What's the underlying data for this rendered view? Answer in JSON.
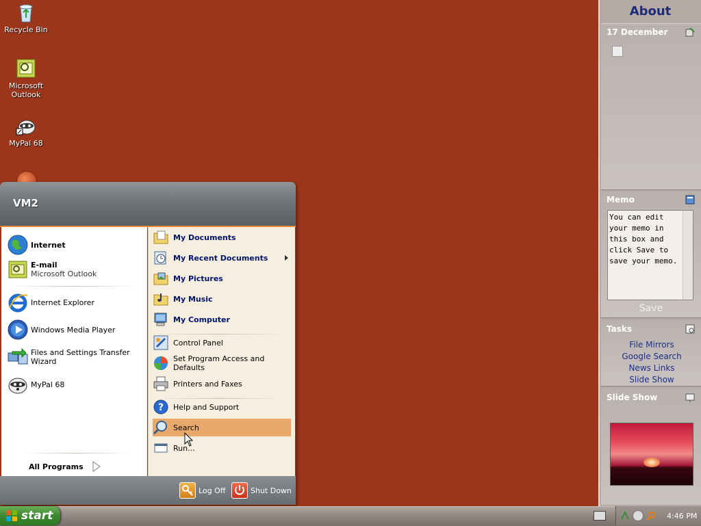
{
  "desktop": {
    "icons": [
      {
        "label": "Recycle Bin",
        "icon": "recycle-bin-icon"
      },
      {
        "label": "Microsoft Outlook",
        "icon": "outlook-icon"
      },
      {
        "label": "MyPal 68",
        "icon": "mypal-icon"
      }
    ]
  },
  "start_menu": {
    "user_name": "VM2",
    "pinned": [
      {
        "label": "Internet",
        "icon": "globe-icon"
      },
      {
        "label": "E-mail",
        "sub": "Microsoft Outlook",
        "icon": "outlook-icon"
      }
    ],
    "recent": [
      {
        "label": "Internet Explorer",
        "icon": "ie-icon"
      },
      {
        "label": "Windows Media Player",
        "icon": "media-player-icon"
      },
      {
        "label": "Files and Settings Transfer Wizard",
        "icon": "transfer-wizard-icon"
      },
      {
        "label": "MyPal 68",
        "icon": "mypal-icon"
      }
    ],
    "all_programs": "All Programs",
    "places": [
      {
        "label": "My Documents",
        "icon": "folder-documents-icon"
      },
      {
        "label": "My Recent Documents",
        "icon": "recent-documents-icon"
      },
      {
        "label": "My Pictures",
        "icon": "folder-pictures-icon"
      },
      {
        "label": "My Music",
        "icon": "folder-music-icon"
      },
      {
        "label": "My Computer",
        "icon": "computer-icon"
      }
    ],
    "system": [
      {
        "label": "Control Panel",
        "icon": "control-panel-icon"
      },
      {
        "label": "Set Program Access and Defaults",
        "icon": "program-defaults-icon"
      },
      {
        "label": "Printers and Faxes",
        "icon": "printer-icon"
      }
    ],
    "help": [
      {
        "label": "Help and Support",
        "icon": "help-icon"
      },
      {
        "label": "Search",
        "icon": "search-icon"
      },
      {
        "label": "Run...",
        "icon": "run-icon"
      }
    ],
    "log_off": "Log Off",
    "shut_down": "Shut Down"
  },
  "taskbar": {
    "start_label": "start",
    "clock": "4:46 PM"
  },
  "sidebar": {
    "title": "About",
    "calendar_header": "17 December",
    "memo_header": "Memo",
    "memo_text": "You can edit your memo in this box and click Save to save your memo.",
    "save_label": "Save",
    "tasks_header": "Tasks",
    "tasks": [
      "File Mirrors",
      "Google Search",
      "News Links",
      "Slide Show"
    ],
    "slideshow_header": "Slide Show"
  },
  "colors": {
    "desktop": "#9b361a",
    "highlight": "#e9a86c",
    "accent": "#e88a3a",
    "start_button": "#3c8a2e"
  }
}
